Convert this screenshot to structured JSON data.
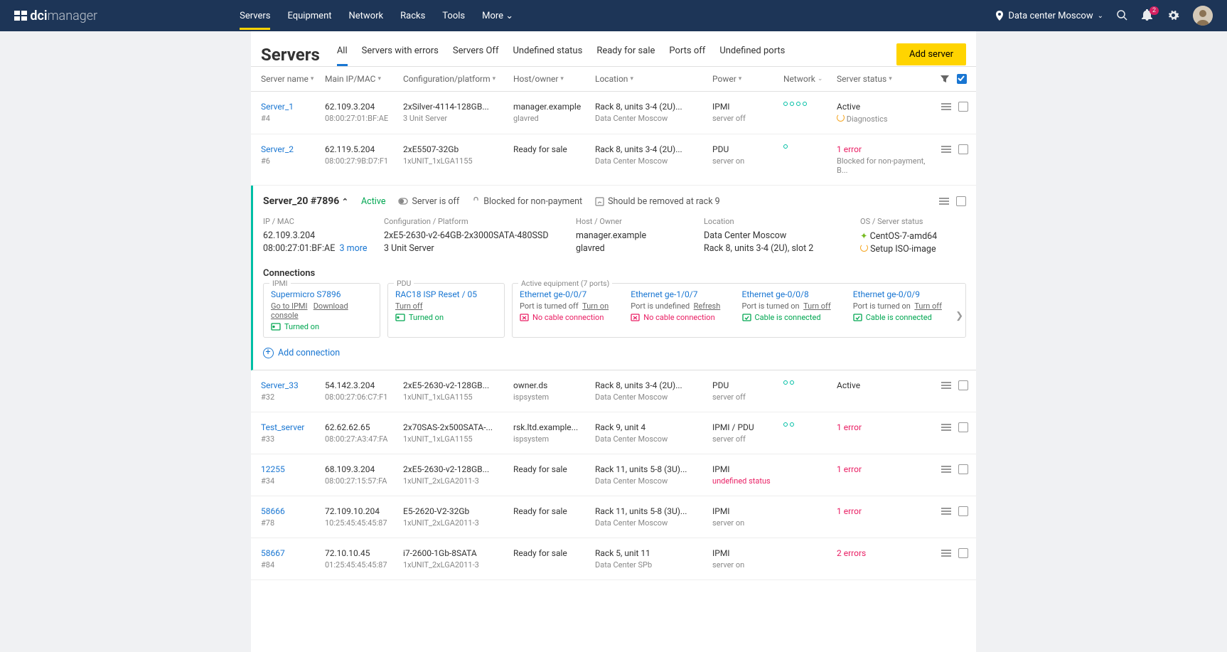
{
  "header": {
    "logo_bold": "dci",
    "logo_light": "manager",
    "nav": [
      "Servers",
      "Equipment",
      "Network",
      "Racks",
      "Tools",
      "More"
    ],
    "active_nav": 0,
    "location": "Data center Moscow",
    "notif_count": "2"
  },
  "page": {
    "title": "Servers",
    "tabs": [
      "All",
      "Servers with errors",
      "Servers Off",
      "Undefined status",
      "Ready for sale",
      "Ports off",
      "Undefined ports"
    ],
    "active_tab": 0,
    "add_btn": "Add server"
  },
  "columns": [
    "Server name",
    "Main  IP/MAC",
    "Configuration/platform",
    "Host/owner",
    "Location",
    "Power",
    "Network",
    "Server status"
  ],
  "rows": [
    {
      "name": "Server_1",
      "id": "#4",
      "ip": "62.109.3.204",
      "mac": "08:00:27:01:BF:AE",
      "conf": "2xSilver-4114-128GB...",
      "plat": "3 Unit Server",
      "host": "manager.example",
      "owner": "glavred",
      "loc": "Rack 8, units 3-4 (2U)...",
      "dc": "Data Center Moscow",
      "pwr": "IPMI",
      "pwr_sub": "server off",
      "net_dots": 4,
      "status1": "Active",
      "status2": "Diagnostics",
      "status2_spin": true
    },
    {
      "name": "Server_2",
      "id": "#6",
      "ip": "62.119.5.204",
      "mac": "08:00:27:9B:D7:F1",
      "conf": "2xE5507-32Gb",
      "plat": "1xUNIT_1xLGA1155",
      "host": "Ready for sale",
      "owner": "",
      "loc": "Rack 8, units 3-4 (2U)...",
      "dc": "Data Center Moscow",
      "pwr": "PDU",
      "pwr_sub": "server on",
      "net_dots": 1,
      "status1": "1 error",
      "status1_err": true,
      "status2": "Blocked for non-payment, B..."
    }
  ],
  "rows2": [
    {
      "name": "Server_33",
      "id": "#32",
      "ip": "54.142.3.204",
      "mac": "08:00:27:06:C7:F1",
      "conf": "2xE5-2630-v2-128GB...",
      "plat": "1xUNIT_1xLGA1155",
      "host": "owner.ds",
      "owner": "ispsystem",
      "loc": "Rack 8, units 3-4 (2U)...",
      "dc": "Data Center Moscow",
      "pwr": "PDU",
      "pwr_sub": "server off",
      "net_dots": 2,
      "status1": "Active"
    },
    {
      "name": "Test_server",
      "id": "#33",
      "ip": "62.62.62.65",
      "mac": "08:00:27:A3:47:FA",
      "conf": "2x70SAS-2x500SATA-...",
      "plat": "1xUNIT_1xLGA1155",
      "host": "rsk.ltd.example...",
      "owner": "ispsystem",
      "loc": "Rack 9, unit 4",
      "dc": "Data Center Moscow",
      "pwr": "IPMI  / PDU",
      "pwr_sub": "server off",
      "net_dots": 2,
      "status1": "1 error",
      "status1_err": true
    },
    {
      "name": "12255",
      "id": "#34",
      "ip": "68.109.3.204",
      "mac": "08:00:27:15:57:FA",
      "conf": "2xE5-2630-v2-128GB...",
      "plat": "1xUNIT_2xLGA2011-3",
      "host": "Ready for sale",
      "owner": "",
      "loc": "Rack 11, units 5-8 (3U)...",
      "dc": "Data Center Moscow",
      "pwr": "IPMI",
      "pwr_sub": "undefined status",
      "pwr_sub_err": true,
      "net_dots": 0,
      "status1": "1 error",
      "status1_err": true
    },
    {
      "name": "58666",
      "id": "#78",
      "ip": "72.109.10.204",
      "mac": "10:25:45:45:45:87",
      "conf": "E5-2620-V2-32Gb",
      "plat": "1xUNIT_2xLGA2011-3",
      "host": "Ready for sale",
      "owner": "",
      "loc": "Rack 11, units 5-8 (3U)...",
      "dc": "Data Center Moscow",
      "pwr": "IPMI",
      "pwr_sub": "server on",
      "net_dots": 0,
      "status1": "1 error",
      "status1_err": true
    },
    {
      "name": "58667",
      "id": "#84",
      "ip": "72.10.10.45",
      "mac": "01:25:45:45:45:87",
      "conf": "i7-2600-1Gb-8SATA",
      "plat": "1xUNIT_2xLGA2011-3",
      "host": "Ready for sale",
      "owner": "",
      "loc": "Rack 5, unit 11",
      "dc": "Data Center SPb",
      "pwr": "IPMI",
      "pwr_sub": "server on",
      "net_dots": 0,
      "status1": "2 errors",
      "status1_err": true
    }
  ],
  "expanded": {
    "title": "Server_20 #7896",
    "status": "Active",
    "chips": [
      "Server is off",
      "Blocked for non-payment",
      "Should be removed at rack 9"
    ],
    "sections": {
      "ipmac": {
        "label": "IP / MAC",
        "v1": "62.109.3.204",
        "v2": "08:00:27:01:BF:AE",
        "more": "3 more"
      },
      "conf": {
        "label": "Configuration / Platform",
        "v1": "2xE5-2630-v2-64GB-2x3000SATA-480SSD",
        "v2": "3 Unit Server"
      },
      "host": {
        "label": "Host / Owner",
        "v1": "manager.example",
        "v2": "glavred"
      },
      "loc": {
        "label": "Location",
        "v1": "Data Center Moscow",
        "v2": "Rack 8, units 3-4 (2U), slot 2"
      },
      "os": {
        "label": "OS / Server status",
        "v1": "CentOS-7-amd64",
        "v2": "Setup ISO-image"
      }
    },
    "conn_title": "Connections",
    "ipmi": {
      "label": "IPMI",
      "name": "Supermicro S7896",
      "l1": "Go to IPMI",
      "l2": "Download console",
      "status": "Turned on"
    },
    "pdu": {
      "label": "PDU",
      "name": "RAC18 ISP Reset / 05",
      "l1": "Turn off",
      "status": "Turned on"
    },
    "active": {
      "label": "Active equipment (7 ports)",
      "ports": [
        {
          "name": "Ethernet ge-0/0/7",
          "sub": "Port is turned off",
          "act": "Turn on",
          "cable": "No cable connection",
          "ok": false
        },
        {
          "name": "Ethernet ge-1/0/7",
          "sub": "Port is undefined",
          "act": "Refresh",
          "cable": "No cable connection",
          "ok": false
        },
        {
          "name": "Ethernet ge-0/0/8",
          "sub": "Port is turned on",
          "act": "Turn off",
          "cable": "Cable is connected",
          "ok": true
        },
        {
          "name": "Ethernet ge-0/0/9",
          "sub": "Port is turned on",
          "act": "Turn off",
          "cable": "Cable is connected",
          "ok": true
        }
      ]
    },
    "add": "Add connection"
  }
}
